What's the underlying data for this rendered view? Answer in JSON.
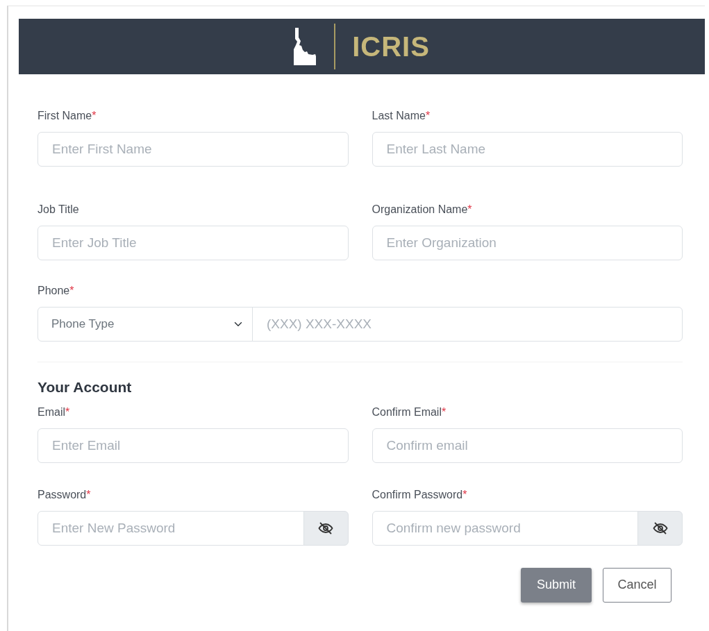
{
  "header": {
    "title": "ICRIS"
  },
  "rows": [
    [
      {
        "label": "First Name",
        "required_mark": "*",
        "placeholder": "Enter First Name",
        "kind": "text"
      },
      {
        "label": "Last Name",
        "required_mark": "*",
        "placeholder": "Enter Last Name",
        "kind": "text"
      }
    ],
    [
      {
        "label": "Job Title",
        "placeholder": "Enter Job Title",
        "kind": "text"
      },
      {
        "label": "Organization Name",
        "required_mark": "*",
        "placeholder": "Enter Organization",
        "kind": "text"
      }
    ]
  ],
  "phone": {
    "label": "Phone",
    "required_mark": "*",
    "type_value": "Phone Type",
    "placeholder": "(XXX) XXX-XXXX"
  },
  "section_title": "Your Account",
  "account_rows": [
    [
      {
        "label": "Email",
        "required_mark": "*",
        "placeholder": "Enter Email",
        "kind": "text"
      },
      {
        "label": "Confirm Email",
        "required_mark": "*",
        "placeholder": "Confirm email",
        "kind": "text"
      }
    ],
    [
      {
        "label": "Password",
        "required_mark": "*",
        "placeholder": "Enter New Password",
        "kind": "password"
      },
      {
        "label": "Confirm Password",
        "required_mark": "*",
        "placeholder": "Confirm new password",
        "kind": "password"
      }
    ]
  ],
  "buttons": [
    {
      "label": "Submit",
      "kind": "primary"
    },
    {
      "label": "Cancel",
      "kind": "secondary"
    }
  ]
}
